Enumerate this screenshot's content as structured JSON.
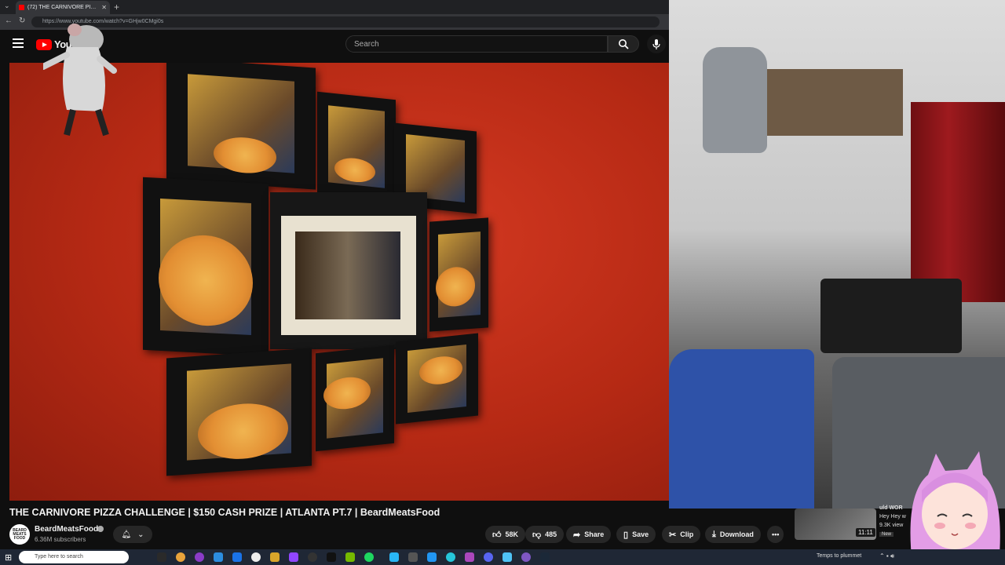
{
  "browser": {
    "tab_title": "(72) THE CARNIVORE PIZZA C",
    "tab_close": "✕",
    "new_tab": "+",
    "url": "https://www.youtube.com/watch?v=GHjw0CMgi0s"
  },
  "youtube": {
    "logo_text": "YouTube",
    "search_placeholder": "Search",
    "video_title": "THE CARNIVORE PIZZA CHALLENGE | $150 CASH PRIZE | ATLANTA PT.7 | BeardMeatsFood",
    "channel": {
      "name": "BeardMeatsFood",
      "subscribers": "6.36M subscribers",
      "avatar_text": "BEARD MEATS FOOD"
    },
    "actions": {
      "likes": "58K",
      "dislikes": "485",
      "share": "Share",
      "save": "Save",
      "clip": "Clip",
      "download": "Download",
      "more": "•••"
    }
  },
  "sidebar_card": {
    "duration": "11:11",
    "title": "uld WOR",
    "channel": "Hey Hey w",
    "views": "9.3K view",
    "badge": "New"
  },
  "taskbar": {
    "search_placeholder": "Type here to search",
    "weather": "Temps to plummet"
  }
}
